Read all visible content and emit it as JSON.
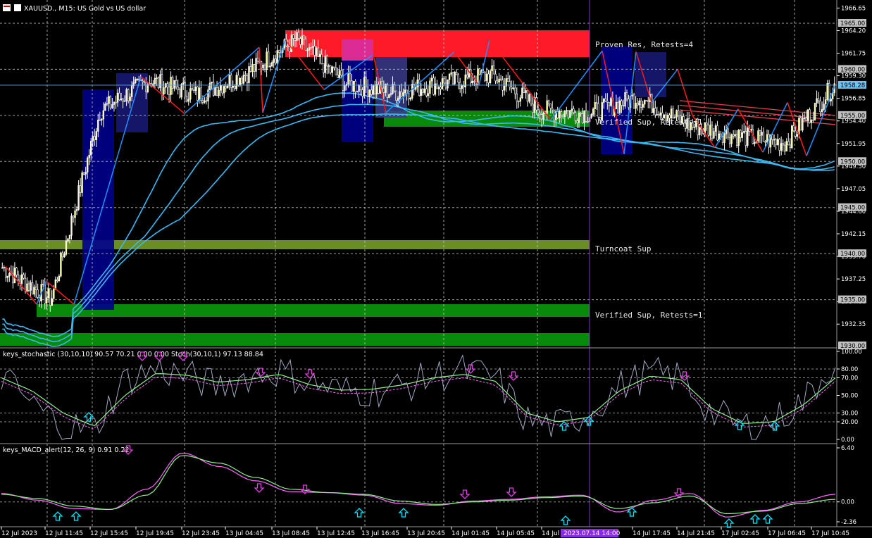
{
  "header": {
    "symbol": "XAUUSD., M15:  US Gold vs US dollar"
  },
  "colors": {
    "background": "#000000",
    "grid": "#c8c8c8",
    "candle": "#ffffff",
    "bull_candle": "#ffff9a",
    "zigzag_up": "#1e90ff",
    "zigzag_down": "#ff1a1a",
    "ma": "#3cb8f0",
    "resistance_zone": "#ff1a2a",
    "verified_support": "#0a8a0a",
    "turncoat_support": "#6b8e23",
    "blue_box": "#00008b",
    "stoch_main": "#a0a8c0",
    "stoch_signal": "#90ee90",
    "macd_line": "#ff66ff",
    "macd_signal": "#90ee90",
    "arrow_up": "#00e5ff",
    "arrow_down": "#e040e0",
    "vertical_marker": "#8a2be2"
  },
  "zones": {
    "proven_res": "Proven Res, Retests=4",
    "verified_sup_1": "Verified Sup, Retests=1",
    "turncoat_sup": "Turncoat Sup",
    "verified_sup_2": "Verified Sup, Retests=1"
  },
  "price_axis": {
    "ticks": [
      "1966.65",
      "1964.20",
      "1961.75",
      "1959.30",
      "1956.85",
      "1954.40",
      "1951.95",
      "1949.50",
      "1947.05",
      "1944.60",
      "1942.15",
      "1939.70",
      "1937.25",
      "1934.80",
      "1932.35"
    ],
    "level_boxes": [
      "1965.00",
      "1960.00",
      "1955.00",
      "1950.00",
      "1945.00",
      "1940.00",
      "1935.00",
      "1930.00"
    ],
    "current_price": "1958.28"
  },
  "stoch_panel": {
    "title": "keys_stochastic (30,10,10) 90.57 70.21 0.00 0.00 Stoch(30,10,1) 97.13 88.84",
    "ticks": [
      "100.00",
      "80.00",
      "70.00",
      "50.00",
      "30.00",
      "20.00",
      "0.00"
    ]
  },
  "macd_panel": {
    "title": "keys_MACD_alert(12, 26, 9) 0.91 0.22",
    "ticks": [
      "6.40",
      "0.00",
      "-2.36"
    ]
  },
  "time_axis": {
    "labels": [
      "12 Jul 2023",
      "12 Jul 11:45",
      "12 Jul 15:45",
      "12 Jul 19:45",
      "12 Jul 23:45",
      "13 Jul 04:45",
      "13 Jul 08:45",
      "13 Jul 12:45",
      "13 Jul 16:45",
      "13 Jul 20:45",
      "14 Jul 01:45",
      "14 Jul 05:45",
      "14 Jul 09:45",
      "14 Jul 17:45",
      "14 Jul 21:45",
      "17 Jul 02:45",
      "17 Jul 06:45",
      "17 Jul 10:45"
    ],
    "cursor_label": "2023.07.14 14:00"
  },
  "chart_data": [
    {
      "type": "candlestick",
      "title": "XAUUSD., M15:  US Gold vs US dollar",
      "ylim": [
        1930.0,
        1967.5
      ],
      "x": [
        "12 Jul 2023",
        "12 Jul 11:45",
        "12 Jul 15:45",
        "12 Jul 19:45",
        "12 Jul 23:45",
        "13 Jul 04:45",
        "13 Jul 08:45",
        "13 Jul 12:45",
        "13 Jul 16:45",
        "13 Jul 20:45",
        "14 Jul 01:45",
        "14 Jul 05:45",
        "14 Jul 09:45",
        "14 Jul 17:45",
        "14 Jul 21:45",
        "17 Jul 02:45",
        "17 Jul 06:45",
        "17 Jul 10:45"
      ],
      "close_path": [
        1938.5,
        1935.0,
        1955.5,
        1958.8,
        1957.2,
        1959.6,
        1963.2,
        1958.5,
        1957.5,
        1958.5,
        1959.4,
        1955.6,
        1955.2,
        1957.0,
        1954.0,
        1952.8,
        1952.0,
        1958.3
      ],
      "zones": [
        {
          "label": "Proven Res, Retests=4",
          "from": 1961.5,
          "to": 1964.4
        },
        {
          "label": "Verified Sup, Retests=1",
          "from": 1953.6,
          "to": 1955.3
        },
        {
          "label": "Turncoat Sup",
          "from": 1940.0,
          "to": 1941.0
        },
        {
          "label": "Verified Sup, Retests=1",
          "from": 1933.4,
          "to": 1934.9
        },
        {
          "label": "",
          "from": 1930.0,
          "to": 1931.4
        }
      ],
      "current_price": 1958.28
    },
    {
      "type": "line",
      "title": "keys_stochastic (30,10,10) 90.57 70.21 0.00 0.00 Stoch(30,10,1) 97.13 88.84",
      "ylim": [
        0,
        100
      ],
      "series": [
        {
          "name": "",
          "values": [
            72,
            40,
            15,
            12,
            68,
            80,
            72,
            60,
            72,
            78,
            65,
            55,
            55,
            60,
            72,
            78,
            70,
            22,
            15,
            30,
            60,
            75,
            70,
            30,
            15,
            20,
            45,
            90
          ]
        },
        {
          "name": "",
          "values": [
            70,
            55,
            30,
            15,
            50,
            75,
            73,
            65,
            68,
            74,
            62,
            56,
            57,
            62,
            70,
            74,
            66,
            30,
            20,
            25,
            55,
            72,
            68,
            35,
            18,
            20,
            40,
            70
          ]
        }
      ]
    },
    {
      "type": "line",
      "title": "keys_MACD_alert(12, 26, 9) 0.91 0.22",
      "ylim": [
        -2.36,
        6.4
      ],
      "series": [
        {
          "name": "",
          "values": [
            1.0,
            0.2,
            -0.8,
            -0.9,
            1.5,
            5.8,
            4.2,
            2.5,
            1.2,
            1.1,
            0.8,
            -0.2,
            -0.4,
            0.1,
            0.3,
            0.6,
            0.8,
            -1.2,
            0.2,
            1.0,
            -1.8,
            -1.0,
            0.0,
            0.9
          ]
        },
        {
          "name": "",
          "values": [
            0.9,
            0.4,
            -0.5,
            -0.9,
            0.8,
            5.5,
            4.6,
            2.9,
            1.5,
            1.1,
            0.9,
            0.1,
            -0.3,
            0.0,
            0.2,
            0.5,
            0.7,
            -0.8,
            -0.1,
            0.7,
            -1.4,
            -1.1,
            -0.2,
            0.3
          ]
        }
      ]
    }
  ]
}
